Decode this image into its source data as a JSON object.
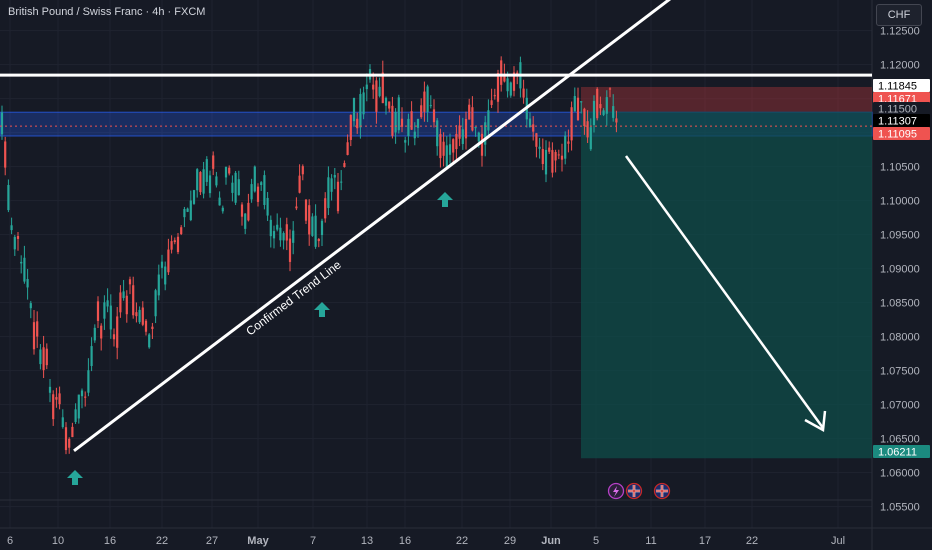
{
  "header": {
    "symbol_title": "British Pound / Swiss Franc · 4h · FXCM",
    "currency_button": "CHF"
  },
  "colors": {
    "background": "#161a25",
    "up": "#26a69a",
    "down": "#ef5350",
    "grid": "#1f2330",
    "resistance": "#ffffff",
    "zone": "#2962ff",
    "stop_zone": "#8b2f35",
    "target_zone": "#0f4c48"
  },
  "chart_data": {
    "type": "candlestick",
    "title": "British Pound / Swiss Franc · 4h · FXCM",
    "ylim": [
      1.0545,
      1.1295
    ],
    "y_ticks": [
      1.125,
      1.12,
      1.115,
      1.11,
      1.105,
      1.1,
      1.095,
      1.09,
      1.085,
      1.08,
      1.075,
      1.07,
      1.065,
      1.06,
      1.055
    ],
    "y_tick_labels": [
      "1.12500",
      "1.12000",
      "1.11500",
      "1.11000",
      "1.10500",
      "1.10000",
      "1.09500",
      "1.09000",
      "1.08500",
      "1.08000",
      "1.07500",
      "1.07000",
      "1.06500",
      "1.06000",
      "1.05500"
    ],
    "x_tick_labels": [
      "6",
      "10",
      "16",
      "22",
      "27",
      "May",
      "7",
      "13",
      "16",
      "22",
      "29",
      "Jun",
      "5",
      "11",
      "17",
      "22",
      "Jul"
    ],
    "price_labels": [
      {
        "value": "1.11845",
        "style": "white"
      },
      {
        "value": "1.11671",
        "style": "red"
      },
      {
        "value": "1.11500",
        "style": "tick"
      },
      {
        "value": "1.11307",
        "style": "black"
      },
      {
        "value": "1.11095",
        "style": "red"
      },
      {
        "value": "1.06211",
        "style": "teal"
      }
    ],
    "levels": {
      "resistance": 1.11845,
      "zone_top": 1.113,
      "zone_bottom": 1.1095,
      "current": 1.11095,
      "stop": 1.11671,
      "entry": 1.11307,
      "target": 1.06211
    },
    "trend_line": {
      "from": {
        "x": "Apr 11",
        "y": 1.0632
      },
      "to": {
        "x": "Jun 22",
        "y": 1.133
      }
    },
    "annotations": {
      "trend_label": "Confirmed Trend Line"
    },
    "path": [
      [
        0,
        1.118
      ],
      [
        3,
        1.109
      ],
      [
        6,
        1.106
      ],
      [
        10,
        1.097
      ],
      [
        14,
        1.093
      ],
      [
        18,
        1.095
      ],
      [
        22,
        1.089
      ],
      [
        26,
        1.09
      ],
      [
        30,
        1.085
      ],
      [
        34,
        1.08
      ],
      [
        38,
        1.081
      ],
      [
        42,
        1.075
      ],
      [
        46,
        1.078
      ],
      [
        50,
        1.072
      ],
      [
        54,
        1.069
      ],
      [
        58,
        1.073
      ],
      [
        62,
        1.068
      ],
      [
        66,
        1.0655
      ],
      [
        70,
        1.0645
      ],
      [
        74,
        1.067
      ],
      [
        78,
        1.069
      ],
      [
        82,
        1.072
      ],
      [
        86,
        1.071
      ],
      [
        90,
        1.076
      ],
      [
        94,
        1.079
      ],
      [
        98,
        1.083
      ],
      [
        102,
        1.08
      ],
      [
        106,
        1.086
      ],
      [
        110,
        1.083
      ],
      [
        114,
        1.08
      ],
      [
        118,
        1.081
      ],
      [
        122,
        1.087
      ],
      [
        126,
        1.084
      ],
      [
        130,
        1.088
      ],
      [
        134,
        1.085
      ],
      [
        138,
        1.083
      ],
      [
        142,
        1.084
      ],
      [
        146,
        1.081
      ],
      [
        150,
        1.079
      ],
      [
        154,
        1.083
      ],
      [
        158,
        1.087
      ],
      [
        162,
        1.091
      ],
      [
        166,
        1.089
      ],
      [
        170,
        1.093
      ],
      [
        174,
        1.095
      ],
      [
        178,
        1.093
      ],
      [
        182,
        1.097
      ],
      [
        186,
        1.1
      ],
      [
        190,
        1.098
      ],
      [
        194,
        1.101
      ],
      [
        198,
        1.104
      ],
      [
        202,
        1.102
      ],
      [
        206,
        1.105
      ],
      [
        210,
        1.103
      ],
      [
        214,
        1.107
      ],
      [
        218,
        1.101
      ],
      [
        222,
        1.098
      ],
      [
        226,
        1.104
      ],
      [
        230,
        1.105
      ],
      [
        234,
        1.101
      ],
      [
        238,
        1.103
      ],
      [
        242,
        1.099
      ],
      [
        246,
        1.097
      ],
      [
        250,
        1.1
      ],
      [
        254,
        1.104
      ],
      [
        258,
        1.101
      ],
      [
        262,
        1.103
      ],
      [
        266,
        1.1
      ],
      [
        270,
        1.097
      ],
      [
        274,
        1.095
      ],
      [
        278,
        1.096
      ],
      [
        282,
        1.094
      ],
      [
        286,
        1.095
      ],
      [
        290,
        1.093
      ],
      [
        294,
        1.096
      ],
      [
        298,
        1.101
      ],
      [
        302,
        1.105
      ],
      [
        306,
        1.099
      ],
      [
        310,
        1.097
      ],
      [
        314,
        1.096
      ],
      [
        318,
        1.094
      ],
      [
        322,
        1.096
      ],
      [
        326,
        1.099
      ],
      [
        330,
        1.102
      ],
      [
        334,
        1.104
      ],
      [
        338,
        1.101
      ],
      [
        342,
        1.104
      ],
      [
        346,
        1.106
      ],
      [
        350,
        1.11
      ],
      [
        354,
        1.113
      ],
      [
        358,
        1.111
      ],
      [
        362,
        1.114
      ],
      [
        366,
        1.116
      ],
      [
        370,
        1.118
      ],
      [
        374,
        1.117
      ],
      [
        378,
        1.115
      ],
      [
        382,
        1.117
      ],
      [
        386,
        1.115
      ],
      [
        390,
        1.113
      ],
      [
        394,
        1.111
      ],
      [
        398,
        1.113
      ],
      [
        402,
        1.111
      ],
      [
        406,
        1.109
      ],
      [
        410,
        1.112
      ],
      [
        414,
        1.11
      ],
      [
        418,
        1.111
      ],
      [
        422,
        1.113
      ],
      [
        426,
        1.116
      ],
      [
        430,
        1.114
      ],
      [
        434,
        1.112
      ],
      [
        438,
        1.109
      ],
      [
        442,
        1.108
      ],
      [
        446,
        1.106
      ],
      [
        450,
        1.107
      ],
      [
        454,
        1.108
      ],
      [
        458,
        1.109
      ],
      [
        462,
        1.11
      ],
      [
        466,
        1.111
      ],
      [
        470,
        1.113
      ],
      [
        474,
        1.111
      ],
      [
        478,
        1.109
      ],
      [
        482,
        1.108
      ],
      [
        486,
        1.111
      ],
      [
        490,
        1.113
      ],
      [
        494,
        1.115
      ],
      [
        498,
        1.117
      ],
      [
        502,
        1.119
      ],
      [
        506,
        1.118
      ],
      [
        510,
        1.116
      ],
      [
        514,
        1.117
      ],
      [
        518,
        1.119
      ],
      [
        522,
        1.118
      ],
      [
        526,
        1.114
      ],
      [
        530,
        1.111
      ],
      [
        534,
        1.11
      ],
      [
        538,
        1.108
      ],
      [
        542,
        1.107
      ],
      [
        546,
        1.106
      ],
      [
        550,
        1.107
      ],
      [
        554,
        1.105
      ],
      [
        558,
        1.107
      ],
      [
        562,
        1.106
      ],
      [
        566,
        1.108
      ],
      [
        570,
        1.11
      ],
      [
        574,
        1.114
      ],
      [
        578,
        1.113
      ],
      [
        582,
        1.115
      ],
      [
        586,
        1.111
      ],
      [
        590,
        1.109
      ],
      [
        594,
        1.113
      ],
      [
        598,
        1.115
      ],
      [
        602,
        1.112
      ],
      [
        606,
        1.114
      ],
      [
        610,
        1.116
      ],
      [
        614,
        1.113
      ],
      [
        618,
        1.111
      ]
    ]
  }
}
